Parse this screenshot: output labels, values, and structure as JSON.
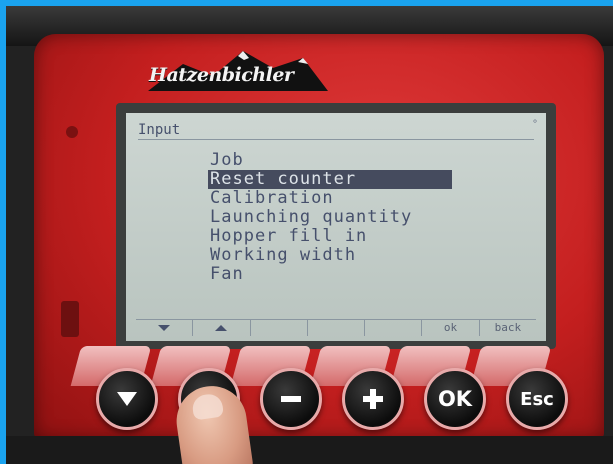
{
  "brand": {
    "logo_text": "Hatzenbichler"
  },
  "screen": {
    "title": "Input",
    "corner_mark": "°",
    "menu_items": [
      {
        "label": "Job",
        "selected": false
      },
      {
        "label": "Reset counter",
        "selected": true
      },
      {
        "label": "Calibration",
        "selected": false
      },
      {
        "label": "Launching quantity",
        "selected": false
      },
      {
        "label": "Hopper fill in",
        "selected": false
      },
      {
        "label": "Working width",
        "selected": false
      },
      {
        "label": "Fan",
        "selected": false
      }
    ],
    "softkeys": [
      {
        "icon": "arrow-down-icon"
      },
      {
        "icon": "arrow-up-icon"
      },
      {
        "label": ""
      },
      {
        "label": ""
      },
      {
        "label": ""
      },
      {
        "label": "ok"
      },
      {
        "label": "back"
      }
    ]
  },
  "buttons": {
    "down": {
      "icon": "down-arrow-icon"
    },
    "up": {
      "icon": "up-arrow-icon"
    },
    "minus": {
      "icon": "minus-icon"
    },
    "plus": {
      "icon": "plus-icon"
    },
    "ok": {
      "label": "OK"
    },
    "esc": {
      "label": "Esc"
    }
  },
  "colors": {
    "background": "#1aa3ef",
    "panel_red": "#c41f1f",
    "lcd_bg": "#c4cec9",
    "lcd_text": "#46506c",
    "selection_bg": "#454b5e"
  }
}
